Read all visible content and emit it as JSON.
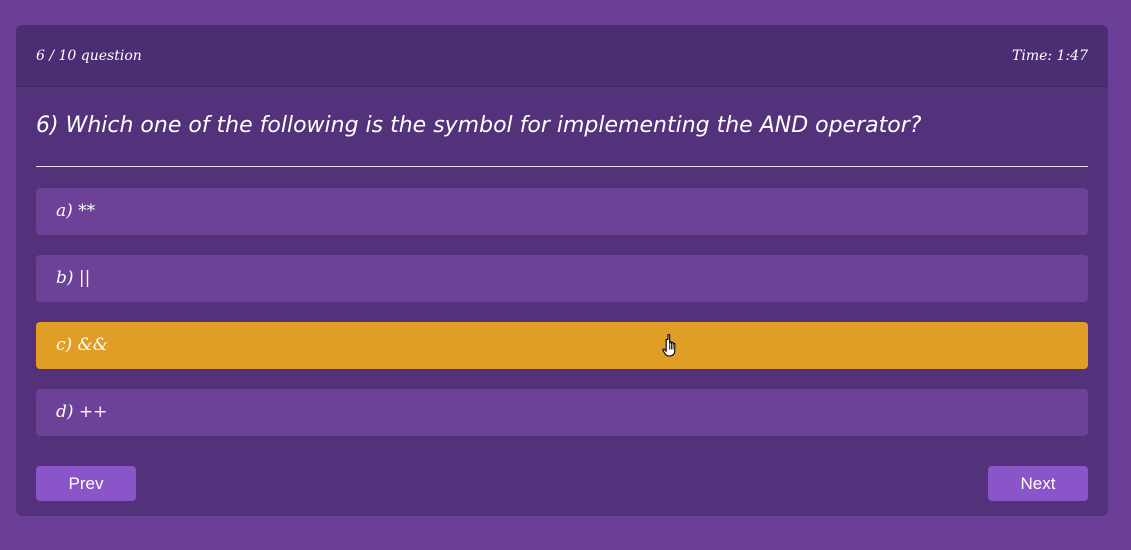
{
  "header": {
    "counter": "6 / 10 question",
    "timer": "Time: 1:47"
  },
  "question": {
    "text": "6) Which one of the following is the symbol for implementing the AND operator?"
  },
  "options": [
    {
      "label": "a) **",
      "selected": false
    },
    {
      "label": "b) ||",
      "selected": false
    },
    {
      "label": "c) &&",
      "selected": true
    },
    {
      "label": "d) ++",
      "selected": false
    }
  ],
  "navigation": {
    "prev_label": "Prev",
    "next_label": "Next"
  },
  "colors": {
    "page_background": "#6b3f98",
    "card_background": "#53327b",
    "option_background": "#6b4298",
    "selected_option": "#e09e27",
    "button_background": "#8a55c8"
  },
  "icons": {
    "cursor": "hand-pointer-icon"
  }
}
